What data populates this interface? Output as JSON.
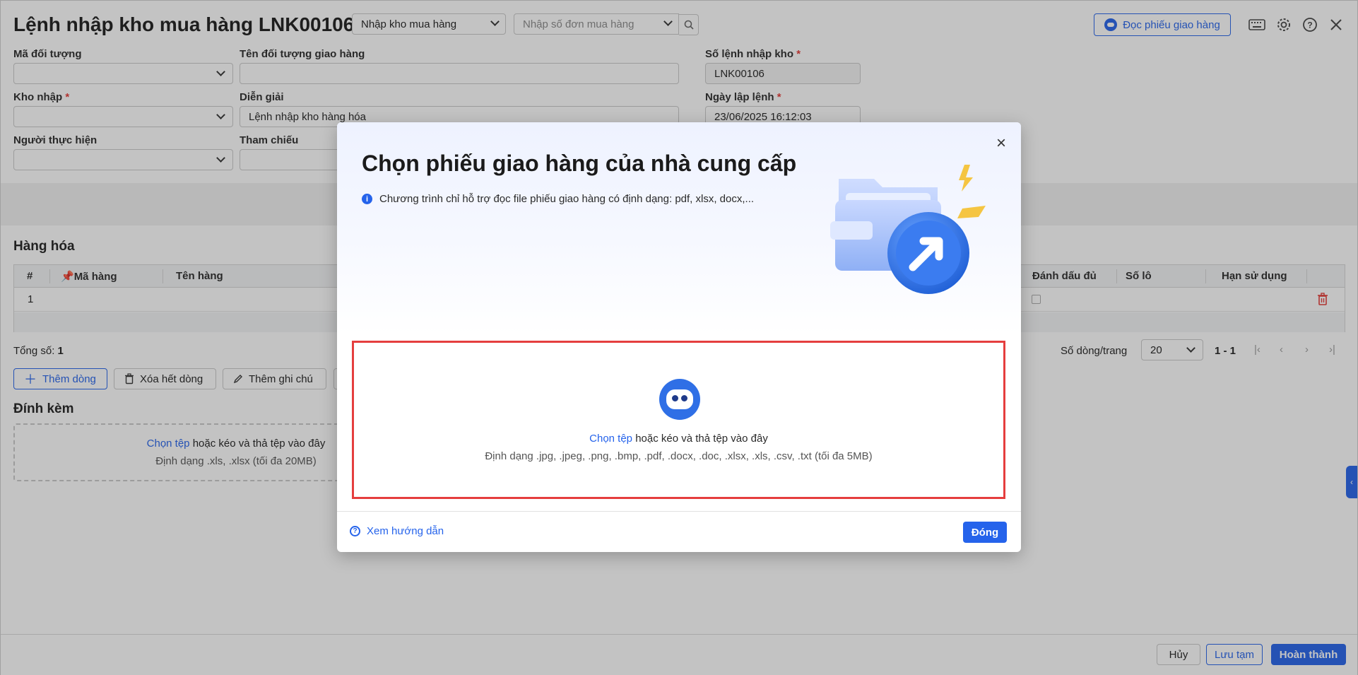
{
  "page": {
    "title": "Lệnh nhập kho mua hàng LNK00106",
    "type_select": "Nhập kho mua hàng",
    "order_placeholder": "Nhập số đơn mua hàng",
    "read_delivery_btn": "Đọc phiếu giao hàng"
  },
  "form": {
    "ma_doi_tuong_label": "Mã đối tượng",
    "ten_doi_tuong_label": "Tên đối tượng giao hàng",
    "kho_nhap_label": "Kho nhập",
    "dien_giai_label": "Diễn giải",
    "dien_giai_value": "Lệnh nhập kho hàng hóa",
    "nguoi_thuc_hien_label": "Người thực hiện",
    "tham_chieu_label": "Tham chiếu",
    "so_lenh_label": "Số lệnh nhập kho",
    "so_lenh_value": "LNK00106",
    "ngay_lap_label": "Ngày lập lệnh",
    "ngay_lap_value": "23/06/2025 16:12:03",
    "required_mark": "*"
  },
  "goods": {
    "title": "Hàng hóa",
    "columns": [
      "#",
      "Mã hàng",
      "Tên hàng",
      "Đánh dấu đủ",
      "Số lô",
      "Hạn sử dụng"
    ],
    "rows": [
      {
        "index": "1"
      }
    ],
    "total_label": "Tổng số:",
    "total_value": "1",
    "add_row": "Thêm dòng",
    "delete_rows": "Xóa hết dòng",
    "add_note": "Thêm ghi chú",
    "per_page_label": "Số dòng/trang",
    "per_page_value": "20",
    "range": "1 - 1"
  },
  "attach": {
    "title": "Đính kèm",
    "choose": "Chọn tệp",
    "drag_text": " hoặc kéo và thả tệp vào đây",
    "format": "Định dạng .xls, .xlsx (tối đa 20MB)"
  },
  "footer": {
    "cancel": "Hủy",
    "save_draft": "Lưu tạm",
    "finish": "Hoàn thành"
  },
  "modal": {
    "title": "Chọn phiếu giao hàng của nhà cung cấp",
    "info": "Chương trình chỉ hỗ trợ đọc file phiếu giao hàng có định dạng: pdf, xlsx, docx,...",
    "choose": "Chọn tệp",
    "drag_text": " hoặc kéo và thả tệp vào đây",
    "format": "Định dạng .jpg, .jpeg, .png, .bmp, .pdf, .docx, .doc, .xlsx, .xls, .csv, .txt (tối đa 5MB)",
    "guide": "Xem hướng dẫn",
    "close": "Đóng"
  },
  "icons": {
    "keyboard": "keyboard-icon",
    "settings": "gear-icon",
    "help": "help-icon",
    "close": "close-icon"
  },
  "colors": {
    "accent": "#2563eb",
    "highlight_border": "#e53e3e",
    "delete_red": "#e53935"
  }
}
